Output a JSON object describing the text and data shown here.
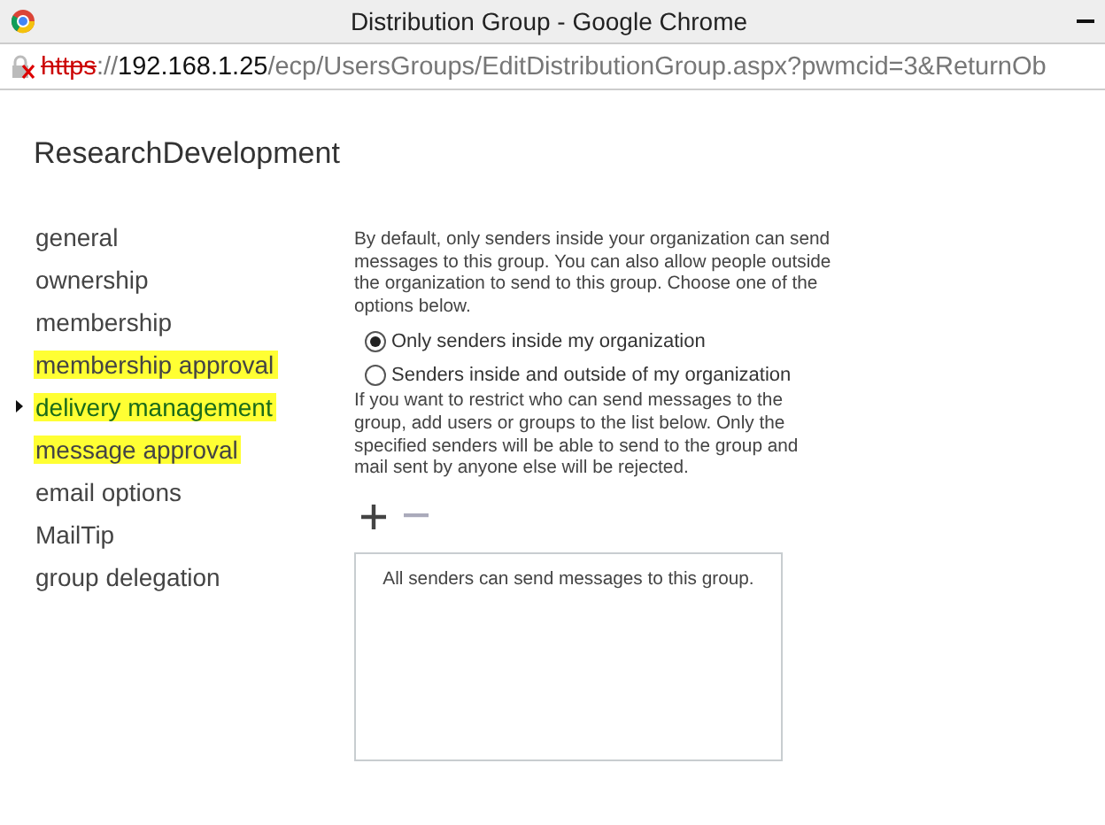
{
  "window": {
    "title": "Distribution Group - Google Chrome"
  },
  "address_bar": {
    "scheme": "https",
    "rest_of_scheme": "://",
    "host": "192.168.1.25",
    "path": "/ecp/UsersGroups/EditDistributionGroup.aspx?pwmcid=3&ReturnOb",
    "insecure": true
  },
  "page_title": "ResearchDevelopment",
  "nav": [
    {
      "label": "general",
      "selected": false,
      "highlighted": false
    },
    {
      "label": "ownership",
      "selected": false,
      "highlighted": false
    },
    {
      "label": "membership",
      "selected": false,
      "highlighted": false
    },
    {
      "label": "membership approval",
      "selected": false,
      "highlighted": true
    },
    {
      "label": "delivery management",
      "selected": true,
      "highlighted": true
    },
    {
      "label": "message approval",
      "selected": false,
      "highlighted": true
    },
    {
      "label": "email options",
      "selected": false,
      "highlighted": false
    },
    {
      "label": "MailTip",
      "selected": false,
      "highlighted": false
    },
    {
      "label": "group delegation",
      "selected": false,
      "highlighted": false
    }
  ],
  "intro": "By default, only senders inside your organization can send messages to this group. You can also allow people outside the organization to send to this group. Choose one of the options below.",
  "options": [
    {
      "label": "Only senders inside my organization",
      "selected": true
    },
    {
      "label": "Senders inside and outside of my organization",
      "selected": false
    }
  ],
  "restrict_text": "If you want to restrict who can send messages to the group, add users or groups to the list below. Only the specified senders will be able to send to the group and mail sent by anyone else will be rejected.",
  "toolbar": [
    {
      "kind": "add",
      "disabled": false
    },
    {
      "kind": "remove",
      "disabled": true
    }
  ],
  "senders_list": {
    "empty_text": "All senders can send messages to this group."
  }
}
